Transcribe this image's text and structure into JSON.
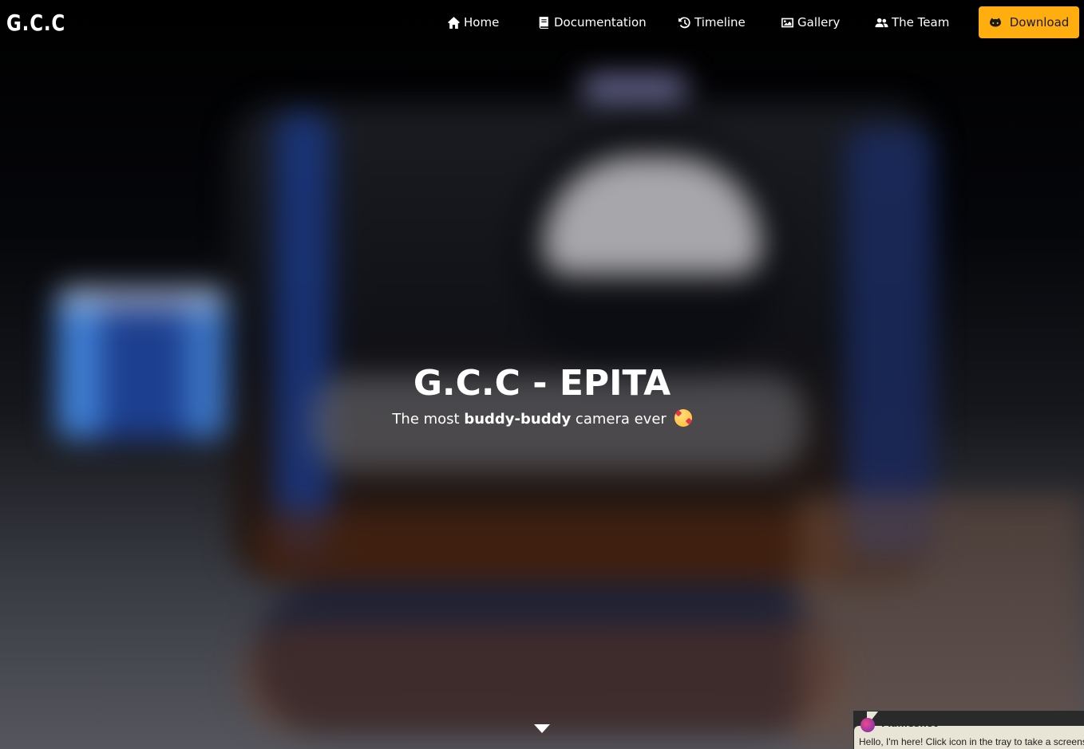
{
  "brand": {
    "name": "G.C.C"
  },
  "nav": {
    "items": [
      {
        "label": "Home",
        "icon": "home-icon"
      },
      {
        "label": "Documentation",
        "icon": "book-icon"
      },
      {
        "label": "Timeline",
        "icon": "history-icon"
      },
      {
        "label": "Gallery",
        "icon": "image-icon"
      },
      {
        "label": "The Team",
        "icon": "users-icon"
      }
    ],
    "download": {
      "label": "Download",
      "icon": "github-icon",
      "color": "#ffad0f"
    }
  },
  "hero": {
    "title": "G.C.C - EPITA",
    "subtitle_prefix": "The most ",
    "subtitle_bold": "buddy-buddy",
    "subtitle_suffix": " camera ever",
    "emoji": "smiling-face-with-hearts-icon",
    "scroll_icon": "caret-down-icon"
  },
  "notification": {
    "app": "Flameshot",
    "message": "Hello, I'm here! Click icon in the tray to take a screenshot"
  }
}
